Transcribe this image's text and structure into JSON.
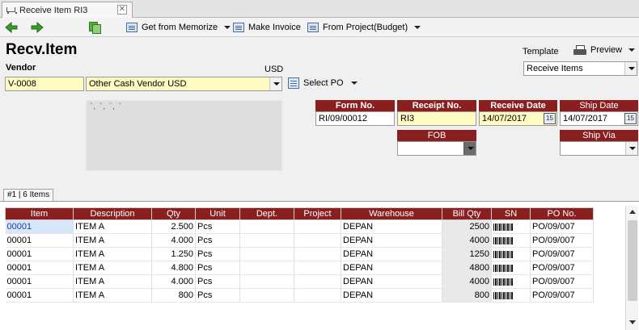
{
  "tab": {
    "title": "Receive Item RI3",
    "close": "✕"
  },
  "toolbar": {
    "get_from_memorize": "Get from Memorize",
    "make_invoice": "Make Invoice",
    "from_project": "From Project(Budget)"
  },
  "page_title": "Recv.Item",
  "vendor": {
    "label": "Vendor",
    "currency": "USD",
    "code": "V-0008",
    "name": "Other Cash Vendor USD",
    "select_po": "Select PO"
  },
  "template": {
    "label": "Template",
    "preview": "Preview",
    "value": "Receive Items"
  },
  "memo_text": "`, `, `, `",
  "fields": {
    "form_no": {
      "label": "Form No.",
      "value": "RI/09/00012"
    },
    "receipt_no": {
      "label": "Receipt No.",
      "value": "RI3"
    },
    "receive_date": {
      "label": "Receive Date",
      "value": "14/07/2017"
    },
    "ship_date": {
      "label": "Ship Date",
      "value": "14/07/2017"
    },
    "fob": {
      "label": "FOB",
      "value": ""
    },
    "ship_via": {
      "label": "Ship Via",
      "value": ""
    },
    "calendar_glyph": "15"
  },
  "grid": {
    "tab_label": "#1 | 6 Items",
    "columns": [
      "Item",
      "Description",
      "Qty",
      "Unit",
      "Dept.",
      "Project",
      "Warehouse",
      "Bill Qty",
      "SN",
      "PO No."
    ],
    "rows": [
      {
        "item": "00001",
        "description": "ITEM A",
        "qty": "2.500",
        "unit": "Pcs",
        "dept": "",
        "project": "",
        "warehouse": "DEPAN",
        "bill_qty": "2500",
        "po_no": "PO/09/007"
      },
      {
        "item": "00001",
        "description": "ITEM A",
        "qty": "4.000",
        "unit": "Pcs",
        "dept": "",
        "project": "",
        "warehouse": "DEPAN",
        "bill_qty": "4000",
        "po_no": "PO/09/007"
      },
      {
        "item": "00001",
        "description": "ITEM A",
        "qty": "1.250",
        "unit": "Pcs",
        "dept": "",
        "project": "",
        "warehouse": "DEPAN",
        "bill_qty": "1250",
        "po_no": "PO/09/007"
      },
      {
        "item": "00001",
        "description": "ITEM A",
        "qty": "4.800",
        "unit": "Pcs",
        "dept": "",
        "project": "",
        "warehouse": "DEPAN",
        "bill_qty": "4800",
        "po_no": "PO/09/007"
      },
      {
        "item": "00001",
        "description": "ITEM A",
        "qty": "4.000",
        "unit": "Pcs",
        "dept": "",
        "project": "",
        "warehouse": "DEPAN",
        "bill_qty": "4000",
        "po_no": "PO/09/007"
      },
      {
        "item": "00001",
        "description": "ITEM A",
        "qty": "800",
        "unit": "Pcs",
        "dept": "",
        "project": "",
        "warehouse": "DEPAN",
        "bill_qty": "800",
        "po_no": "PO/09/007"
      }
    ]
  },
  "colors": {
    "header_maroon": "#8a1f1f",
    "required_yellow": "#fffbc2",
    "selection_blue": "#d6e6fb"
  }
}
